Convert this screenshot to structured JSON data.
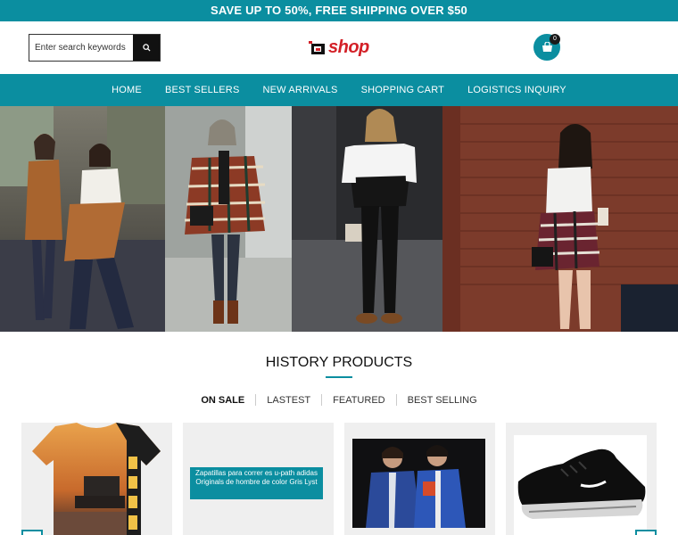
{
  "promo": {
    "text": "SAVE UP TO 50%, FREE SHIPPING OVER $50"
  },
  "header": {
    "search_placeholder": "Enter search keywords here",
    "logo_text": "shop",
    "cart_count": "0"
  },
  "nav": {
    "items": [
      "HOME",
      "BEST SELLERS",
      "NEW ARRIVALS",
      "SHOPPING CART",
      "LOGISTICS INQUIRY"
    ]
  },
  "section": {
    "title": "HISTORY PRODUCTS",
    "tabs": [
      "ON SALE",
      "LASTEST",
      "FEATURED",
      "BEST SELLING"
    ]
  },
  "products": [
    {
      "kind": "t-shirt"
    },
    {
      "alt_text": "Zapatillas para correr es u-path adidas Originals de hombre de color Gris Lyst"
    },
    {
      "kind": "jackets"
    },
    {
      "kind": "sneaker"
    }
  ],
  "colors": {
    "accent": "#0b8ea0",
    "logo": "#d32027"
  }
}
